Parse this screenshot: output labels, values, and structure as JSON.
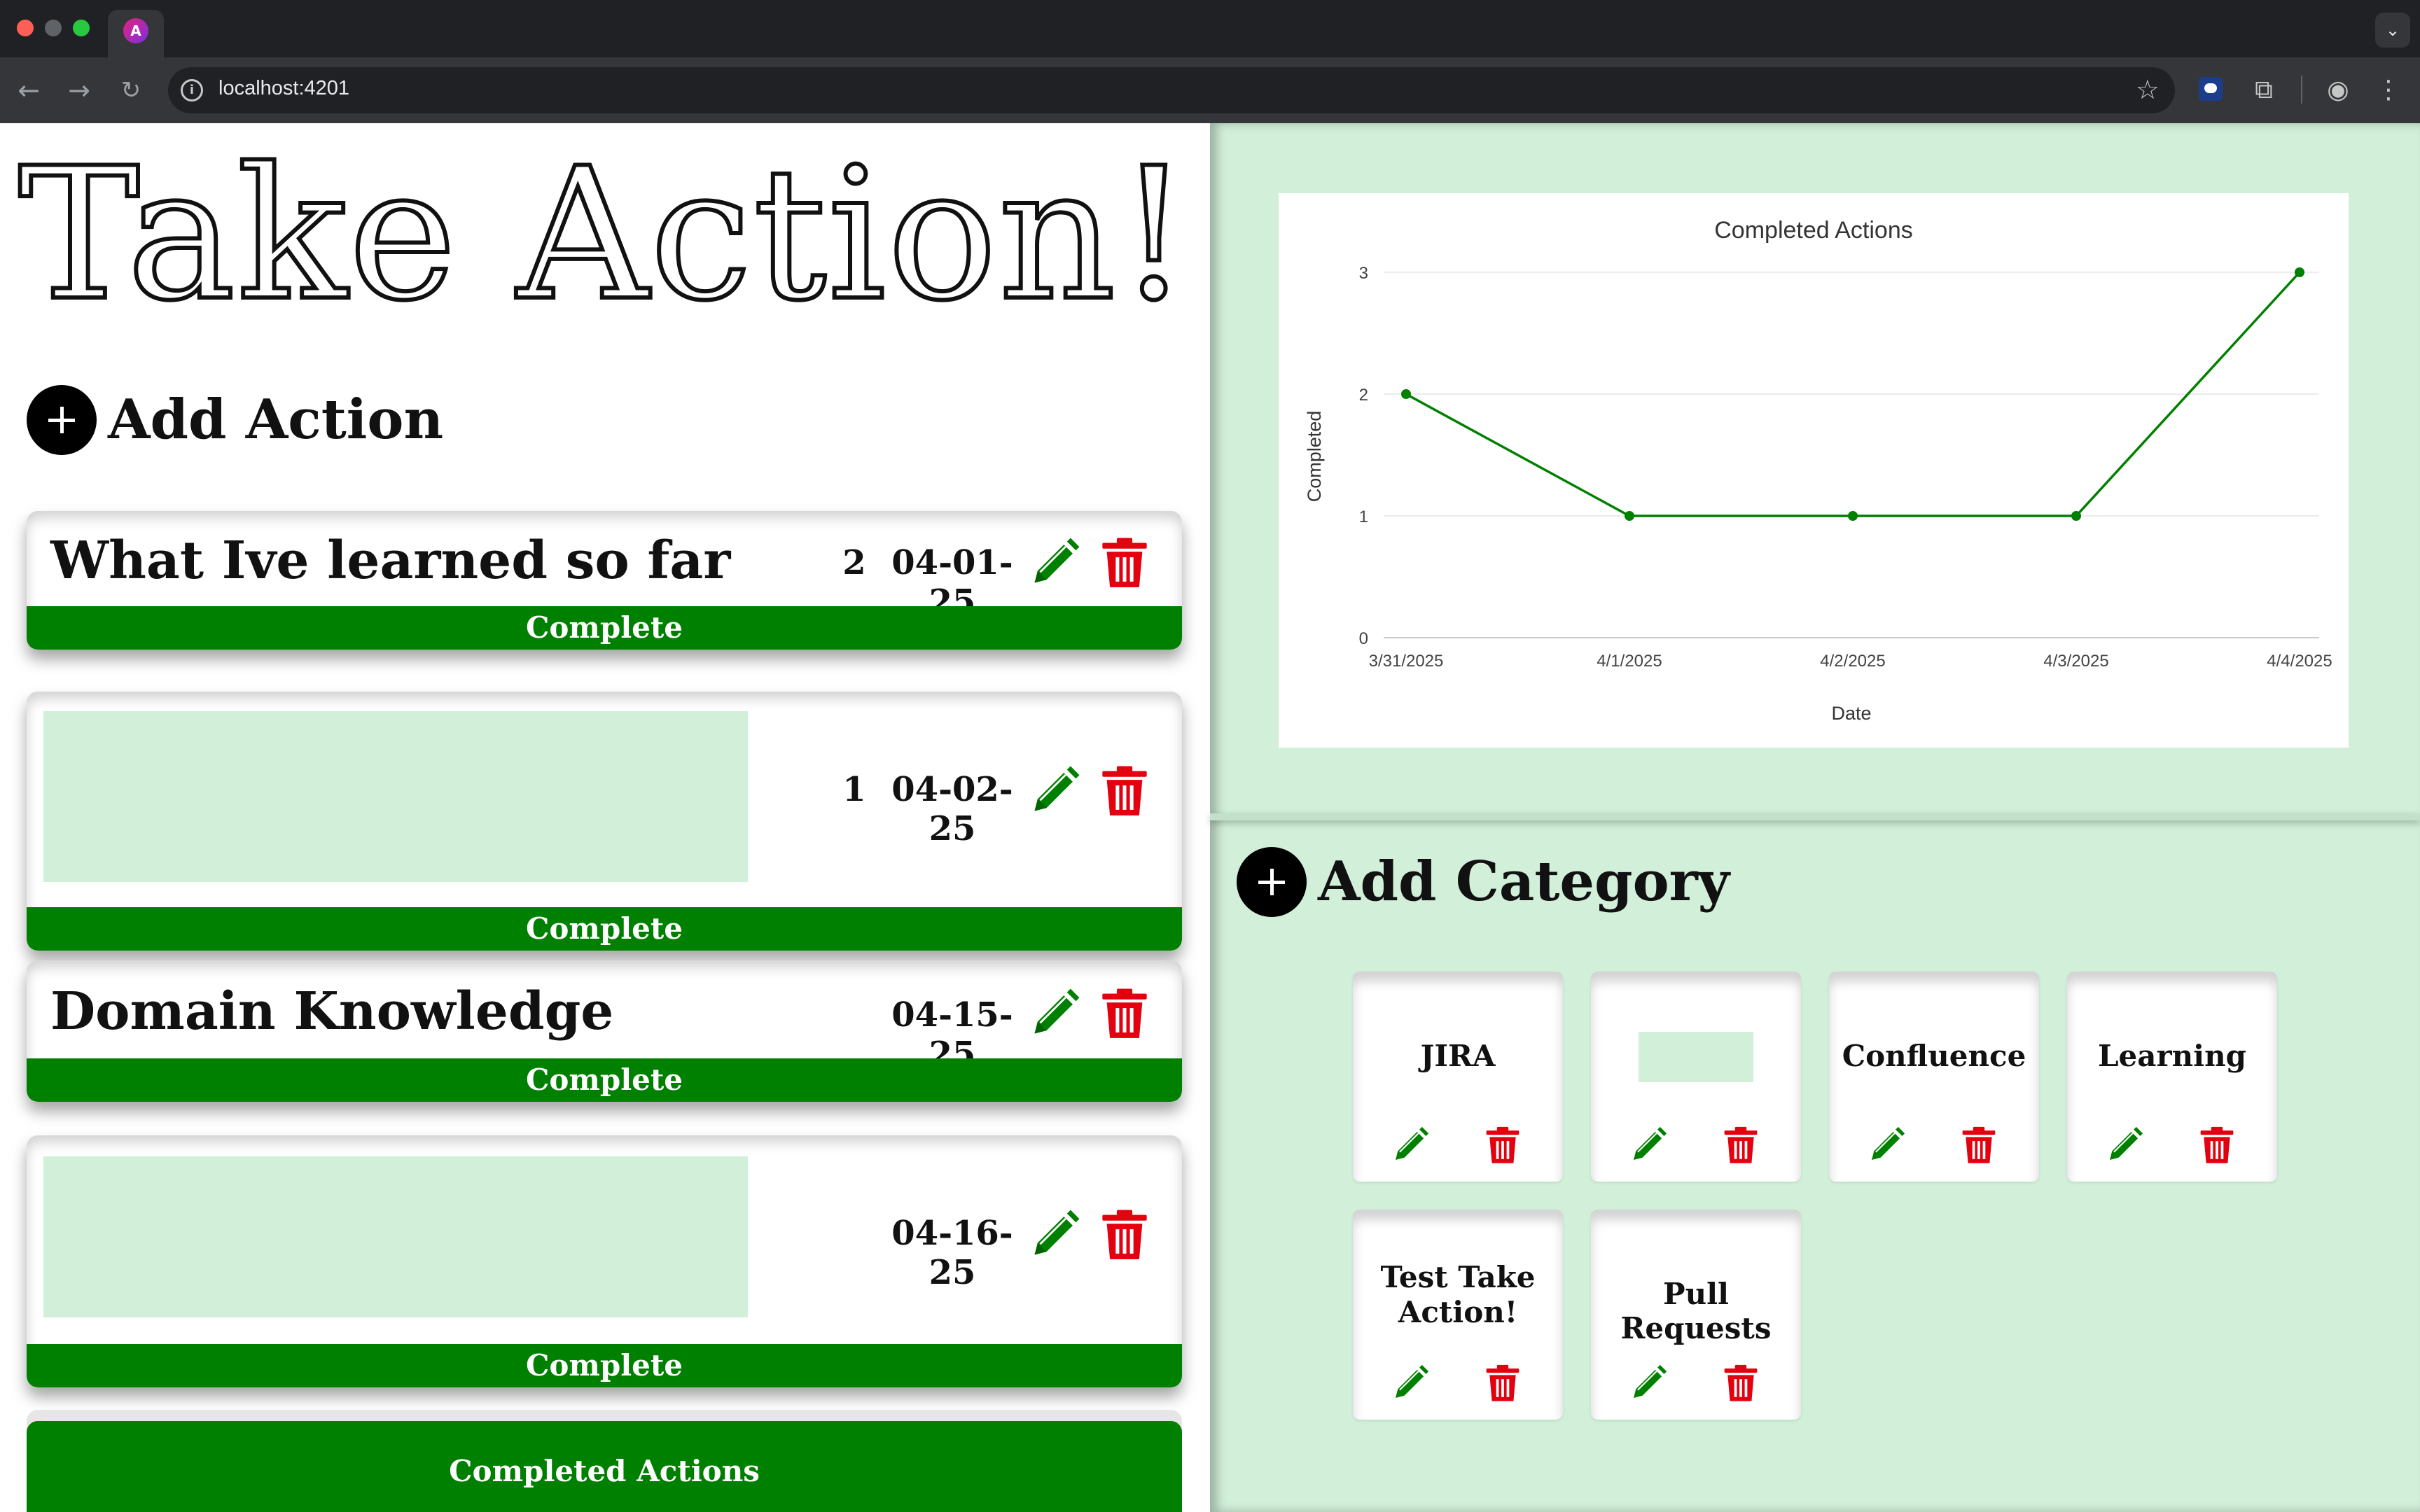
{
  "browser": {
    "url": "localhost:4201",
    "tab_favicon_glyph": "A"
  },
  "app": {
    "title": "Take Action!",
    "add_action_label": "Add Action",
    "add_category_label": "Add Category",
    "completed_actions_label": "Completed Actions"
  },
  "actions": [
    {
      "title": "What Ive learned so far",
      "count": "2",
      "date": "04-01-25",
      "complete_label": "Complete",
      "has_image": false
    },
    {
      "title": "",
      "count": "1",
      "date": "04-02-25",
      "complete_label": "Complete",
      "has_image": true
    },
    {
      "title": "Domain Knowledge",
      "count": "",
      "date": "04-15-25",
      "complete_label": "Complete",
      "has_image": false
    },
    {
      "title": "",
      "count": "",
      "date": "04-16-25",
      "complete_label": "Complete",
      "has_image": true
    }
  ],
  "categories": [
    {
      "name": "JIRA",
      "has_image": false
    },
    {
      "name": "",
      "has_image": true
    },
    {
      "name": "Confluence",
      "has_image": false
    },
    {
      "name": "Learning",
      "has_image": false
    },
    {
      "name": "Test Take Action!",
      "has_image": false
    },
    {
      "name": "Pull Requests",
      "has_image": false
    }
  ],
  "icons": {
    "edit": "pencil-icon",
    "delete": "trash-icon",
    "add": "plus-icon"
  },
  "colors": {
    "accent_green": "#008000",
    "delete_red": "#e3000f",
    "panel_green": "#d1efd9"
  },
  "chart_data": {
    "type": "line",
    "title": "Completed Actions",
    "xlabel": "Date",
    "ylabel": "Completed",
    "x": [
      "3/31/2025",
      "4/1/2025",
      "4/2/2025",
      "4/3/2025",
      "4/4/2025"
    ],
    "series": [
      {
        "values": [
          2,
          1,
          1,
          1,
          3
        ]
      }
    ],
    "ylim": [
      0,
      3
    ],
    "yticks": [
      0,
      1,
      2,
      3
    ],
    "grid": true,
    "color": "#008000"
  }
}
